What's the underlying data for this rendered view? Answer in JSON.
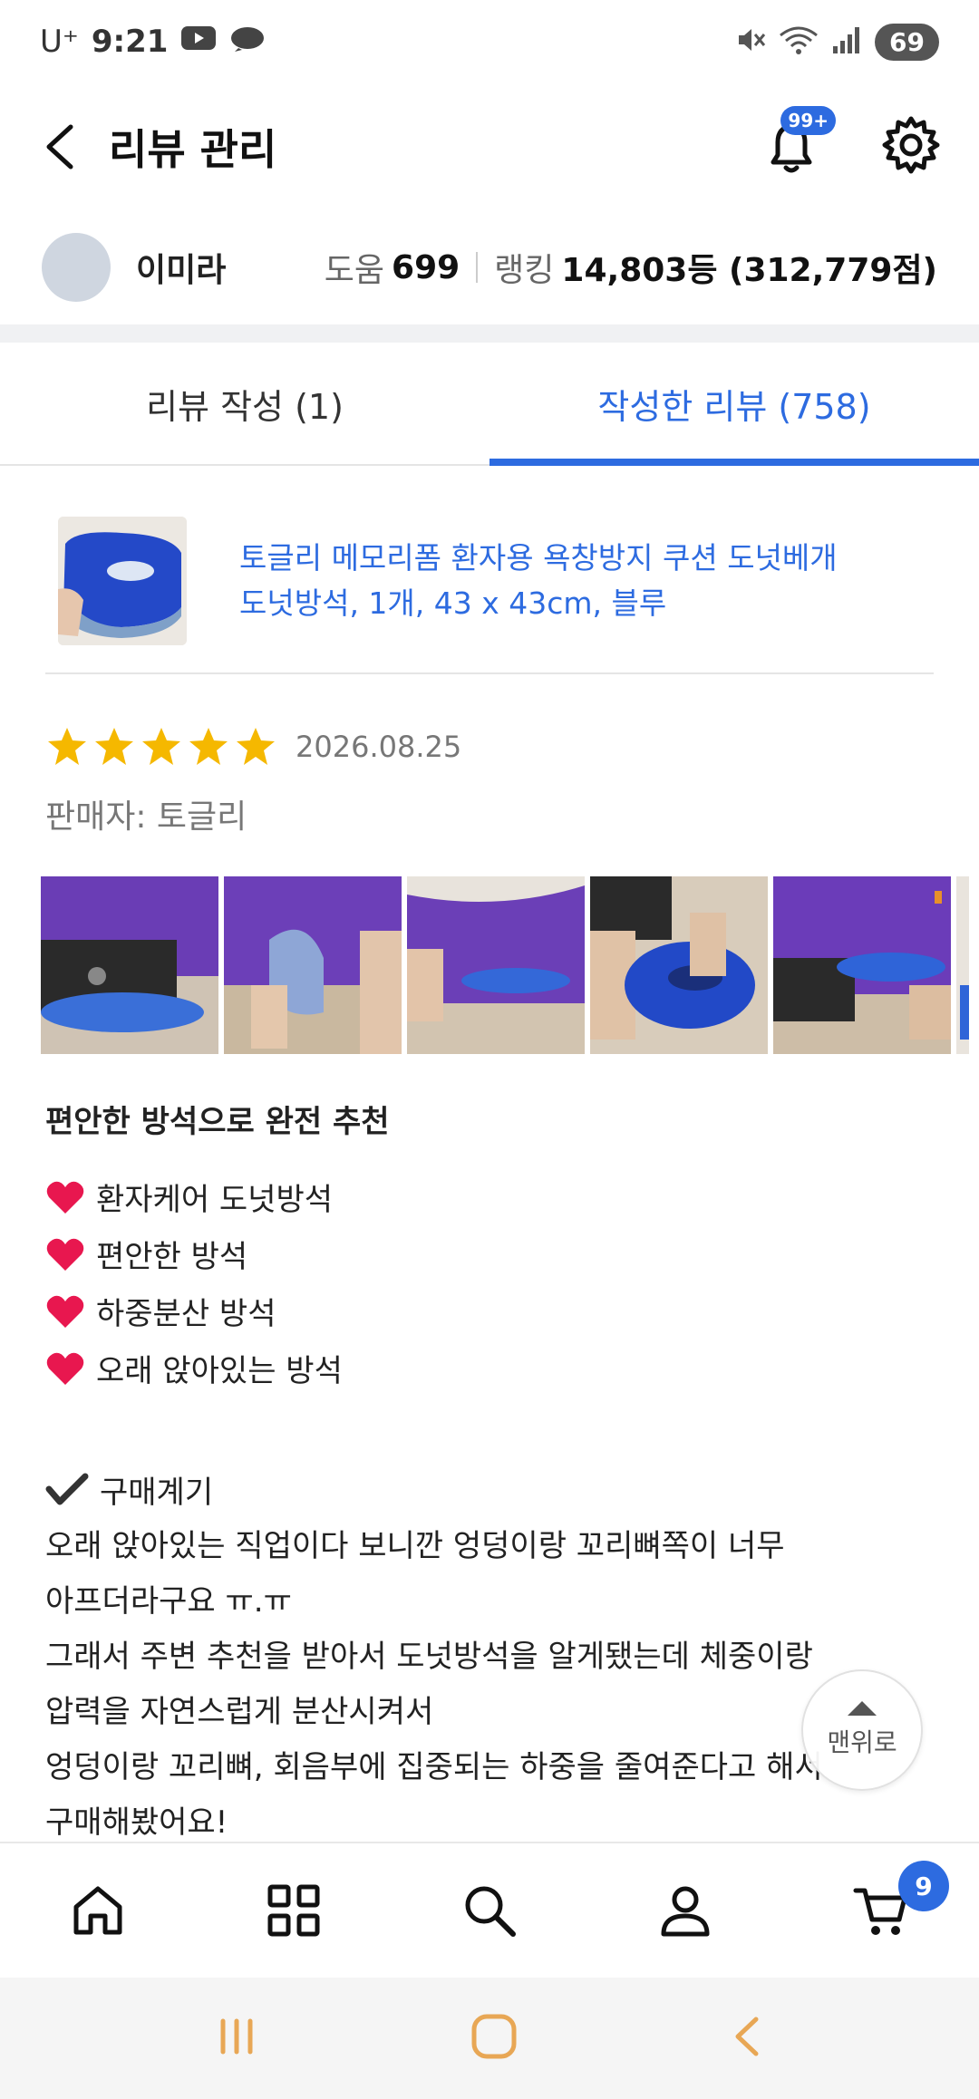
{
  "status_bar": {
    "carrier": "U⁺",
    "time": "9:21",
    "battery": "69"
  },
  "header": {
    "title": "리뷰 관리",
    "notification_badge": "99+"
  },
  "profile": {
    "name": "이미라",
    "help_label": "도움",
    "help_value": "699",
    "rank_label": "랭킹",
    "rank_value": "14,803등 (312,779점)"
  },
  "tabs": [
    {
      "label": "리뷰 작성 (1)",
      "active": false
    },
    {
      "label": "작성한 리뷰 (758)",
      "active": true
    }
  ],
  "product": {
    "title_line1": "토글리 메모리폼 환자용 욕창방지 쿠션 도넛베개",
    "title_line2": "도넛방석, 1개, 43 x 43cm, 블루"
  },
  "review": {
    "rating": 5,
    "date": "2026.08.25",
    "seller": "판매자: 토글리",
    "heading": "편안한 방석으로 완전 추천",
    "bullets": [
      "환자케어 도넛방석",
      "편안한 방석",
      "하중분산 방석",
      "오래 앉아있는 방석"
    ],
    "purchase_label": "구매계기",
    "paragraph": [
      "오래 앉아있는 직업이다 보니깐 엉덩이랑 꼬리뼈쪽이 너무",
      "아프더라구요 ㅠ.ㅠ",
      "그래서 주변 추천을 받아서 도넛방석을 알게됐는데 체중이랑",
      "압력을 자연스럽게 분산시켜서",
      "엉덩이랑 꼬리뼈, 회음부에 집중되는 하중을 줄여준다고 해서",
      "구매해봤어요!"
    ]
  },
  "scroll_top_label": "맨위로",
  "bottom_nav": {
    "cart_count": "9"
  },
  "colors": {
    "accent": "#2d6be0",
    "star": "#f5b800",
    "heart": "#e8174f"
  }
}
